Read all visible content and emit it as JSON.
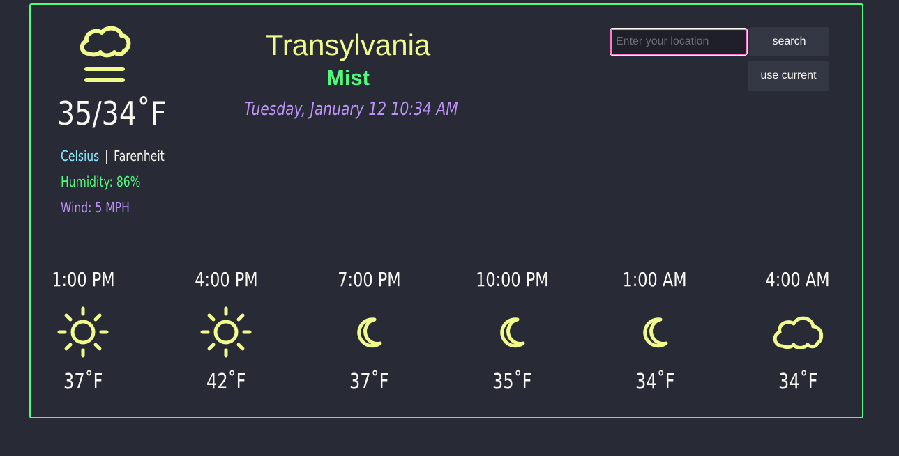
{
  "current": {
    "icon": "fog-cloud-icon",
    "temperature": "35/34˚F",
    "unit_celsius": "Celsius",
    "unit_separator": "|",
    "unit_fahrenheit": "Farenheit",
    "humidity": "Humidity: 86%",
    "wind": "Wind: 5 MPH"
  },
  "location": {
    "city": "Transylvania",
    "condition": "Mist",
    "datetime": "Tuesday, January 12 10:34 AM"
  },
  "search": {
    "placeholder": "Enter your location",
    "search_label": "search",
    "current_label": "use current"
  },
  "forecast": [
    {
      "time": "1:00 PM",
      "icon": "sun-icon",
      "temp": "37˚F"
    },
    {
      "time": "4:00 PM",
      "icon": "sun-icon",
      "temp": "42˚F"
    },
    {
      "time": "7:00 PM",
      "icon": "moon-icon",
      "temp": "37˚F"
    },
    {
      "time": "10:00 PM",
      "icon": "moon-icon",
      "temp": "35˚F"
    },
    {
      "time": "1:00 AM",
      "icon": "moon-icon",
      "temp": "34˚F"
    },
    {
      "time": "4:00 AM",
      "icon": "cloud-icon",
      "temp": "34˚F"
    }
  ],
  "colors": {
    "background": "#282a36",
    "border": "#50fa7b",
    "icon": "#f1fa8c",
    "celsius": "#8be9fd",
    "humidity": "#50fa7b",
    "wind": "#bd93f9",
    "datetime": "#bd93f9"
  }
}
